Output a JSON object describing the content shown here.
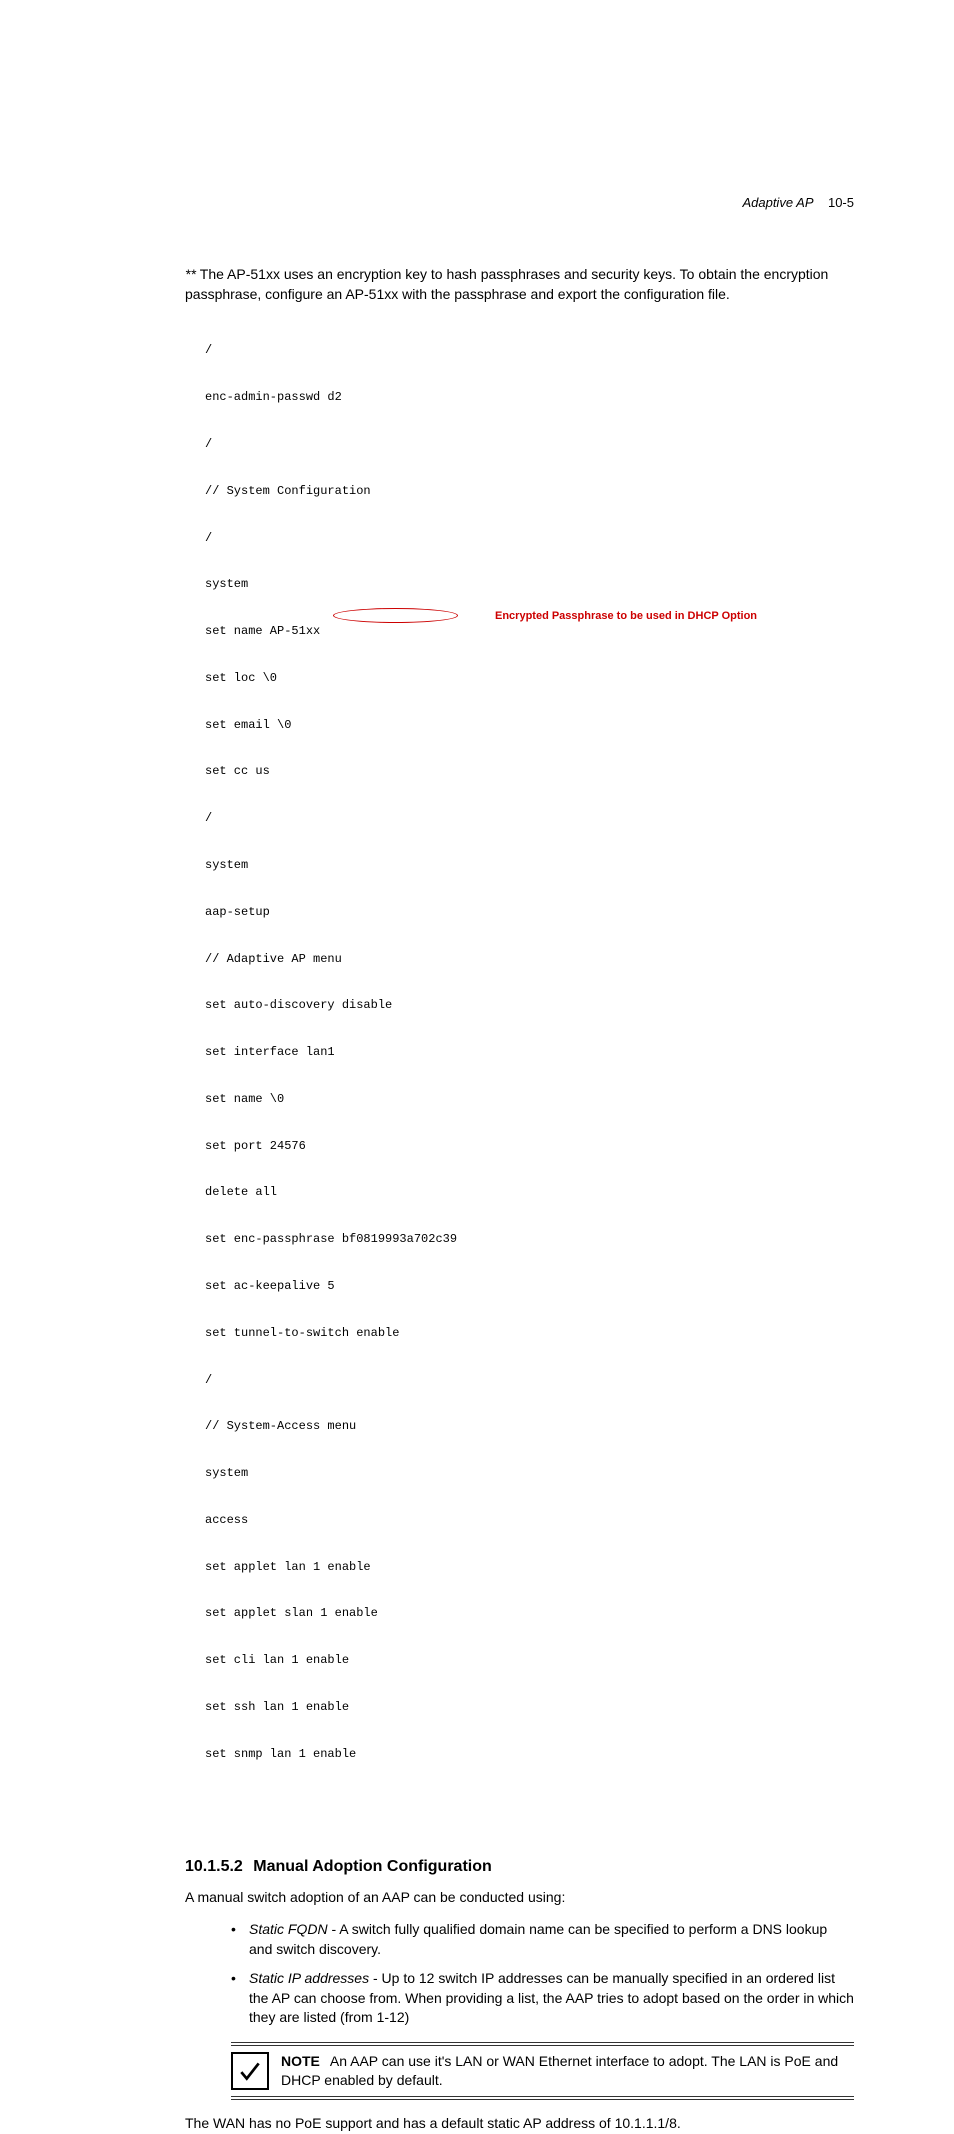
{
  "header": {
    "title": "Adaptive AP",
    "pagenum": "10-5"
  },
  "intro": {
    "stars": "** ",
    "text": "The AP-51xx uses an encryption key to hash passphrases and security keys. To obtain the encryption passphrase, configure an AP-51xx with the passphrase and export the configuration file."
  },
  "code": {
    "lines": [
      "/",
      "enc-admin-passwd d2",
      "/",
      "// System Configuration",
      "/",
      "system",
      "set name AP-51xx",
      "set loc \\0",
      "set email \\0",
      "set cc us",
      "/",
      "system",
      "aap-setup",
      "// Adaptive AP menu",
      "set auto-discovery disable",
      "set interface lan1",
      "set name \\0",
      "set port 24576",
      "delete all",
      "set enc-passphrase bf0819993a702c39",
      "set ac-keepalive 5",
      "set tunnel-to-switch enable",
      "/",
      "// System-Access menu",
      "system",
      "access",
      "set applet lan 1 enable",
      "set applet slan 1 enable",
      "set cli lan 1 enable",
      "set ssh lan 1 enable",
      "set snmp lan 1 enable"
    ],
    "callout": "Encrypted Passphrase to be used in DHCP Option"
  },
  "section": {
    "number": "10.1.5.2",
    "title": "Manual Adoption Configuration",
    "para": "A manual switch adoption of an AAP can be conducted using:",
    "bullets": [
      {
        "name": "Static FQDN",
        "text": " - A switch fully qualified domain name can be specified to perform a DNS lookup and switch discovery."
      },
      {
        "name": "Static IP addresses",
        "text": " - Up to 12 switch IP addresses can be manually specified in an ordered list the AP can choose from. When providing a list, the AAP tries to adopt based on the order in which they are listed (from 1-12)"
      }
    ],
    "note": {
      "label": "NOTE",
      "text": "An AAP can use it's LAN or WAN Ethernet interface to adopt. The LAN is PoE and DHCP enabled by default."
    },
    "after": "The WAN has no PoE support and has a default static AP address of 10.1.1.1/8."
  }
}
